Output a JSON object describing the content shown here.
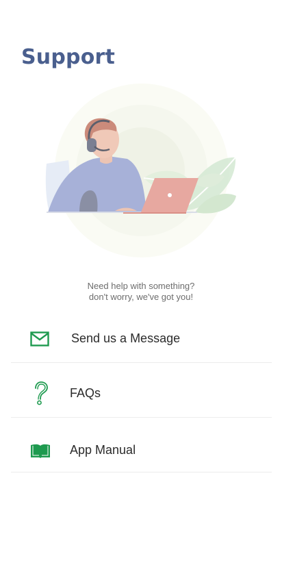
{
  "page": {
    "title": "Support"
  },
  "hero": {
    "illustration": "support-agent-illustration",
    "tagline_line1": "Need help with something?",
    "tagline_line2": "don't worry, we've got you!"
  },
  "menu": {
    "items": [
      {
        "label": "Send us a Message",
        "icon": "envelope-icon"
      },
      {
        "label": "FAQs",
        "icon": "question-mark-icon"
      },
      {
        "label": "App Manual",
        "icon": "book-icon"
      }
    ]
  },
  "colors": {
    "title": "#4a5f8e",
    "accent_green": "#1e9a4f",
    "text": "#2b2b2b",
    "muted_text": "#6d6d6d",
    "divider": "#ececec"
  }
}
